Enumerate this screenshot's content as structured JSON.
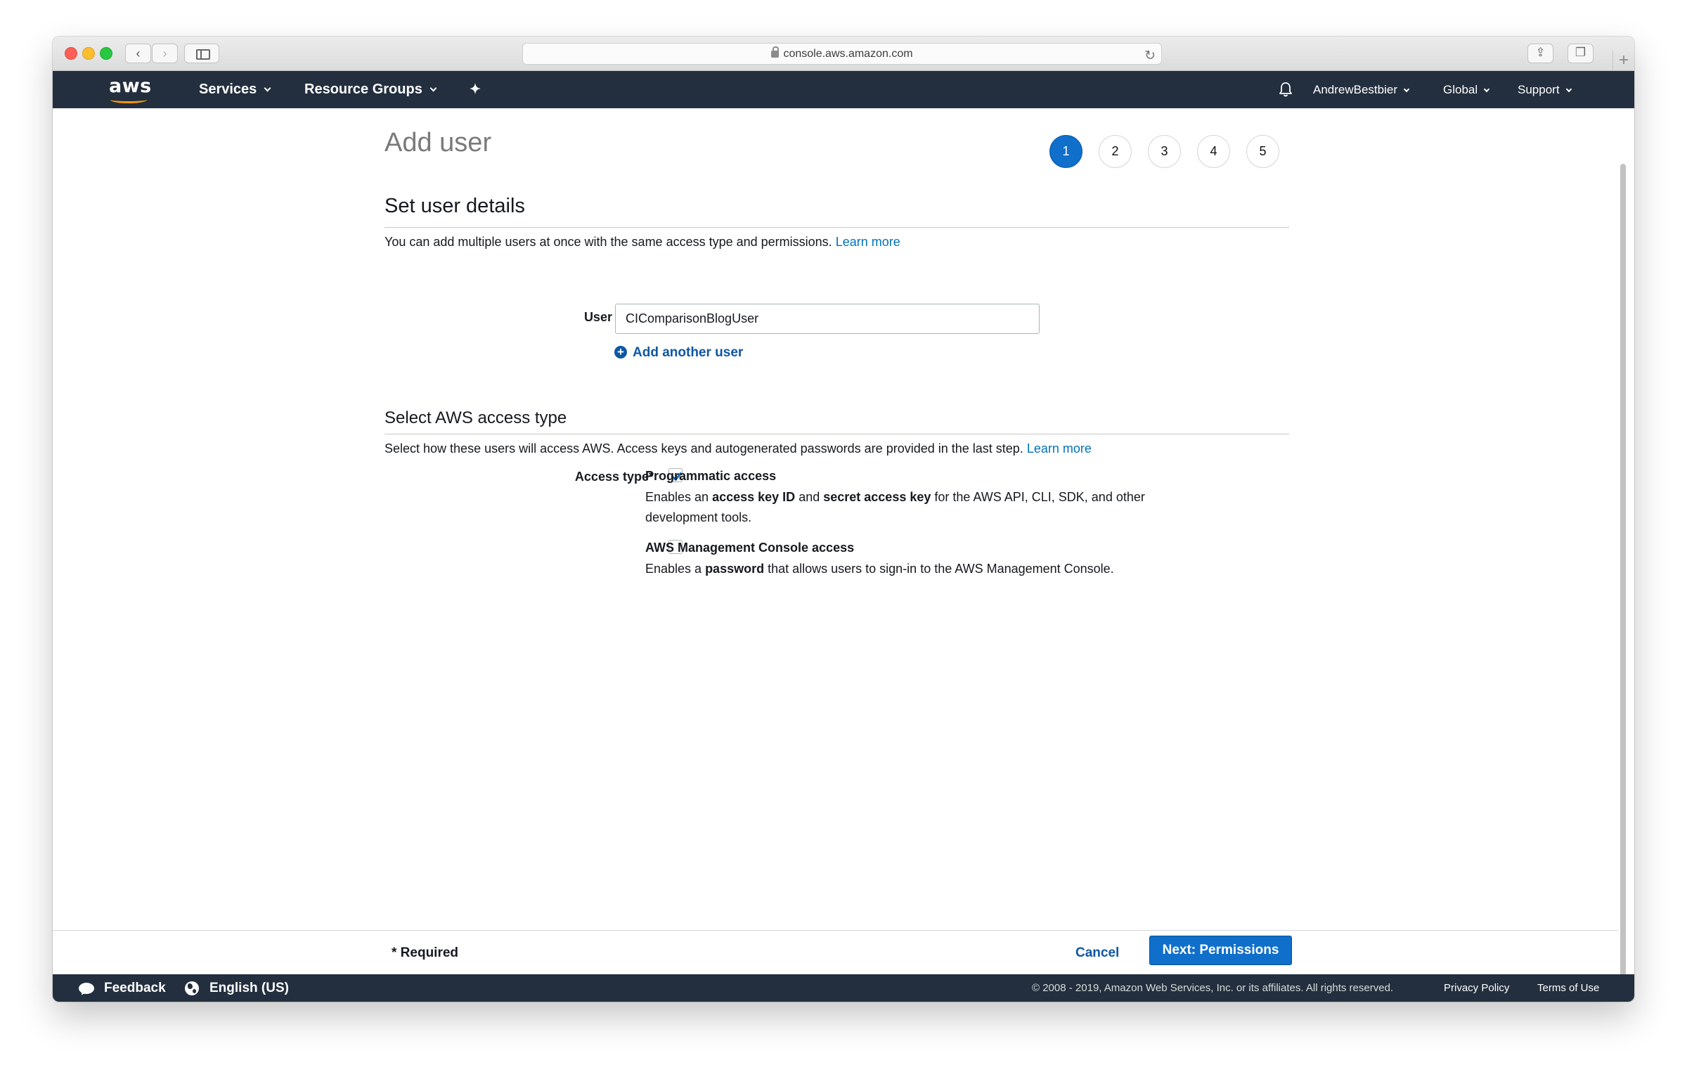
{
  "browser": {
    "url": "console.aws.amazon.com",
    "back_glyph": "‹",
    "forward_glyph": "›",
    "reload_glyph": "↻",
    "share_glyph": "⇪",
    "tabs_glyph": "❐",
    "newtab_glyph": "+"
  },
  "nav": {
    "logo_text": "aws",
    "services": "Services",
    "resource_groups": "Resource Groups",
    "pin_glyph": "✦",
    "account": "AndrewBestbier",
    "region": "Global",
    "support": "Support"
  },
  "page": {
    "title": "Add user",
    "steps": [
      "1",
      "2",
      "3",
      "4",
      "5"
    ],
    "active_step": 1
  },
  "user_details": {
    "title": "Set user details",
    "description": "You can add multiple users at once with the same access type and permissions.",
    "learn_more": "Learn more",
    "user_name_label": "User name*",
    "user_name_value": "CIComparisonBlogUser",
    "add_another": "Add another user"
  },
  "access_type": {
    "title": "Select AWS access type",
    "description": "Select how these users will access AWS. Access keys and autogenerated passwords are provided in the last step.",
    "learn_more": "Learn more",
    "label": "Access type*",
    "programmatic": {
      "title": "Programmatic access",
      "checked": true,
      "desc_1": "Enables an ",
      "desc_bold_1": "access key ID",
      "desc_2": " and ",
      "desc_bold_2": "secret access key",
      "desc_3": " for the AWS API, CLI, SDK, and other development tools."
    },
    "console": {
      "title": "AWS Management Console access",
      "checked": false,
      "desc_1": "Enables a ",
      "desc_bold_1": "password",
      "desc_2": " that allows users to sign-in to the AWS Management Console."
    }
  },
  "actions": {
    "required_note": "* Required",
    "cancel": "Cancel",
    "next": "Next: Permissions"
  },
  "footer": {
    "feedback": "Feedback",
    "language": "English (US)",
    "copyright": "© 2008 - 2019, Amazon Web Services, Inc. or its affiliates. All rights reserved.",
    "privacy": "Privacy Policy",
    "terms": "Terms of Use"
  },
  "colors": {
    "nav_bg": "#232f3e",
    "primary": "#0f6fca",
    "link": "#0073bb",
    "logo_accent": "#ff9900"
  }
}
